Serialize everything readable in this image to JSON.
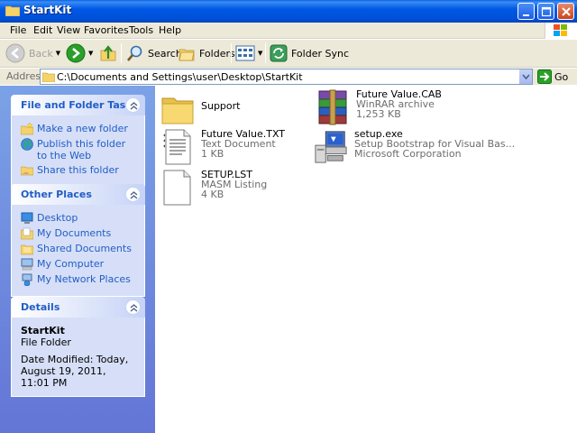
{
  "window": {
    "title": "StartKit",
    "buttons": {
      "minimize": "minimize-icon",
      "maximize": "maximize-icon",
      "close": "close-icon"
    }
  },
  "menu": [
    "File",
    "Edit",
    "View",
    "Favorites",
    "Tools",
    "Help"
  ],
  "toolbar": {
    "back_label": "Back",
    "search_label": "Search",
    "folders_label": "Folders",
    "sync_label": "Folder Sync"
  },
  "address": {
    "label": "Address",
    "value": "C:\\Documents and Settings\\user\\Desktop\\StartKit",
    "go_label": "Go"
  },
  "sidebar": {
    "tasks": {
      "title": "File and Folder Tasks",
      "items": [
        {
          "label": "Make a new folder",
          "icon": "new-folder-icon"
        },
        {
          "label": "Publish this folder to the Web",
          "icon": "globe-icon"
        },
        {
          "label": "Share this folder",
          "icon": "share-folder-icon"
        }
      ]
    },
    "places": {
      "title": "Other Places",
      "items": [
        {
          "label": "Desktop",
          "icon": "desktop-icon"
        },
        {
          "label": "My Documents",
          "icon": "my-documents-icon"
        },
        {
          "label": "Shared Documents",
          "icon": "shared-documents-icon"
        },
        {
          "label": "My Computer",
          "icon": "my-computer-icon"
        },
        {
          "label": "My Network Places",
          "icon": "network-places-icon"
        }
      ]
    },
    "details": {
      "title": "Details",
      "name": "StartKit",
      "type": "File Folder",
      "modified": "Date Modified: Today, August 19, 2011, 11:01 PM"
    }
  },
  "files": [
    {
      "name": "Support",
      "line2": "",
      "line3": "",
      "icon": "folder-icon"
    },
    {
      "name": "Future Value.CAB",
      "line2": "WinRAR archive",
      "line3": "1,253 KB",
      "icon": "winrar-archive-icon"
    },
    {
      "name": "Future Value.TXT",
      "line2": "Text Document",
      "line3": "1 KB",
      "icon": "text-document-icon"
    },
    {
      "name": "setup.exe",
      "line2": "Setup Bootstrap for Visual Bas...",
      "line3": "Microsoft Corporation",
      "icon": "setup-exe-icon"
    },
    {
      "name": "SETUP.LST",
      "line2": "MASM Listing",
      "line3": "4 KB",
      "icon": "listing-file-icon"
    }
  ],
  "colors": {
    "titlebar": "#0054e3",
    "sidebar_top": "#7ba2e7",
    "sidebar_bottom": "#6375d6",
    "link": "#215dc6",
    "chrome": "#ece9d8"
  }
}
